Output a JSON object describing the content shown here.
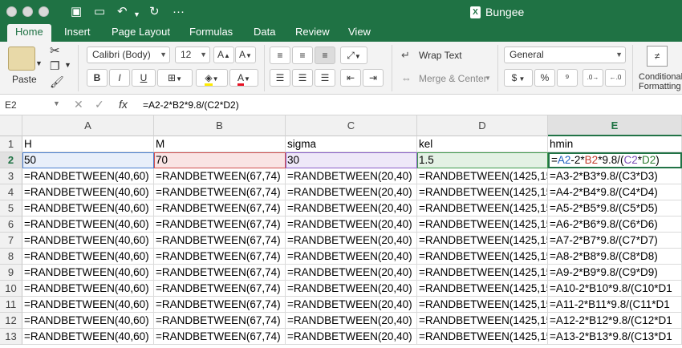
{
  "window": {
    "title": "Bungee"
  },
  "tabs": [
    "Home",
    "Insert",
    "Page Layout",
    "Formulas",
    "Data",
    "Review",
    "View"
  ],
  "ribbon": {
    "paste_label": "Paste",
    "font_name": "Calibri (Body)",
    "font_size": "12",
    "wrap_text": "Wrap Text",
    "merge_center": "Merge & Center",
    "number_format": "General",
    "conditional_formatting_1": "Conditional",
    "conditional_formatting_2": "Formatting",
    "currency_symbol": "$",
    "percent_symbol": "%"
  },
  "formula_bar": {
    "name_box": "E2",
    "fx": "fx",
    "formula": "=A2-2*B2*9.8/(C2*D2)"
  },
  "columns": [
    "A",
    "B",
    "C",
    "D",
    "E"
  ],
  "rows": [
    [
      "H",
      "M",
      "sigma",
      "kel",
      "hmin"
    ],
    [
      "50",
      "70",
      "30",
      "1.5",
      "=A2-2*B2*9.8/(C2*D2)"
    ],
    [
      "=RANDBETWEEN(40,60)",
      "=RANDBETWEEN(67,74)",
      "=RANDBETWEEN(20,40)",
      "=RANDBETWEEN(1425,15",
      "=A3-2*B3*9.8/(C3*D3)"
    ],
    [
      "=RANDBETWEEN(40,60)",
      "=RANDBETWEEN(67,74)",
      "=RANDBETWEEN(20,40)",
      "=RANDBETWEEN(1425,15",
      "=A4-2*B4*9.8/(C4*D4)"
    ],
    [
      "=RANDBETWEEN(40,60)",
      "=RANDBETWEEN(67,74)",
      "=RANDBETWEEN(20,40)",
      "=RANDBETWEEN(1425,15",
      "=A5-2*B5*9.8/(C5*D5)"
    ],
    [
      "=RANDBETWEEN(40,60)",
      "=RANDBETWEEN(67,74)",
      "=RANDBETWEEN(20,40)",
      "=RANDBETWEEN(1425,15",
      "=A6-2*B6*9.8/(C6*D6)"
    ],
    [
      "=RANDBETWEEN(40,60)",
      "=RANDBETWEEN(67,74)",
      "=RANDBETWEEN(20,40)",
      "=RANDBETWEEN(1425,15",
      "=A7-2*B7*9.8/(C7*D7)"
    ],
    [
      "=RANDBETWEEN(40,60)",
      "=RANDBETWEEN(67,74)",
      "=RANDBETWEEN(20,40)",
      "=RANDBETWEEN(1425,15",
      "=A8-2*B8*9.8/(C8*D8)"
    ],
    [
      "=RANDBETWEEN(40,60)",
      "=RANDBETWEEN(67,74)",
      "=RANDBETWEEN(20,40)",
      "=RANDBETWEEN(1425,15",
      "=A9-2*B9*9.8/(C9*D9)"
    ],
    [
      "=RANDBETWEEN(40,60)",
      "=RANDBETWEEN(67,74)",
      "=RANDBETWEEN(20,40)",
      "=RANDBETWEEN(1425,15",
      "=A10-2*B10*9.8/(C10*D1"
    ],
    [
      "=RANDBETWEEN(40,60)",
      "=RANDBETWEEN(67,74)",
      "=RANDBETWEEN(20,40)",
      "=RANDBETWEEN(1425,15",
      "=A11-2*B11*9.8/(C11*D1"
    ],
    [
      "=RANDBETWEEN(40,60)",
      "=RANDBETWEEN(67,74)",
      "=RANDBETWEEN(20,40)",
      "=RANDBETWEEN(1425,15",
      "=A12-2*B12*9.8/(C12*D1"
    ],
    [
      "=RANDBETWEEN(40,60)",
      "=RANDBETWEEN(67,74)",
      "=RANDBETWEEN(20,40)",
      "=RANDBETWEEN(1425,15",
      "=A13-2*B13*9.8/(C13*D1"
    ]
  ],
  "row_numbers": [
    "1",
    "2",
    "3",
    "4",
    "5",
    "6",
    "7",
    "8",
    "9",
    "10",
    "11",
    "12",
    "13"
  ],
  "colors": {
    "accent": "#1f7244",
    "ref_blue": "#1f5fc0",
    "ref_red": "#c0392b",
    "ref_purple": "#7a4bb5",
    "ref_green": "#2e7d32"
  }
}
